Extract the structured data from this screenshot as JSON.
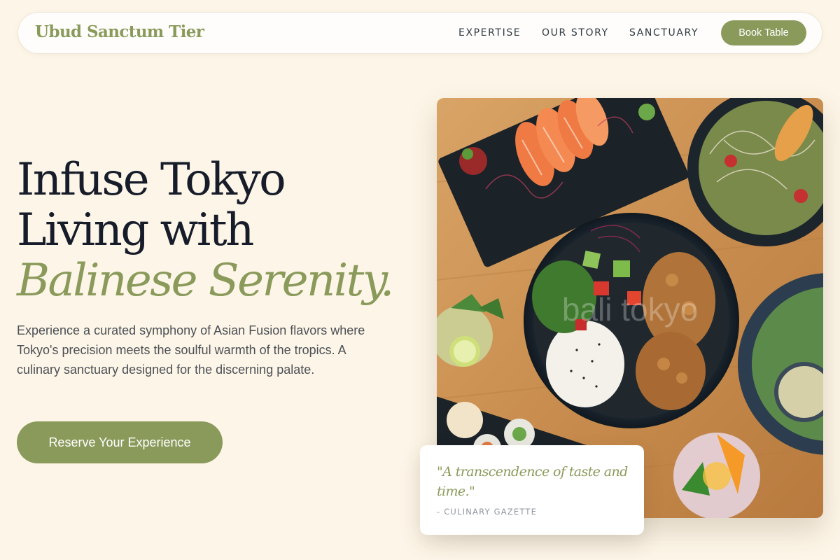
{
  "nav": {
    "brand": "Ubud Sanctum Tier",
    "links": [
      "EXPERTISE",
      "OUR STORY",
      "SANCTUARY"
    ],
    "book_label": "Book Table"
  },
  "hero": {
    "headline_line1": "Infuse Tokyo",
    "headline_line2": "Living with",
    "headline_accent": "Balinese Serenity.",
    "description": "Experience a curated symphony of Asian Fusion flavors where Tokyo's precision meets the soulful warmth of the tropics. A culinary sanctuary designed for the discerning palate.",
    "cta_label": "Reserve Your Experience"
  },
  "image": {
    "subject": "overhead-asian-fusion-dishes",
    "watermark": "bali tokyo"
  },
  "quote": {
    "text": "\"A transcendence of taste and time.\"",
    "source": "- CULINARY GAZETTE"
  },
  "colors": {
    "background": "#fdf5e7",
    "accent": "#8a9a5b",
    "headline": "#161c29",
    "body_text": "#4b5056"
  }
}
